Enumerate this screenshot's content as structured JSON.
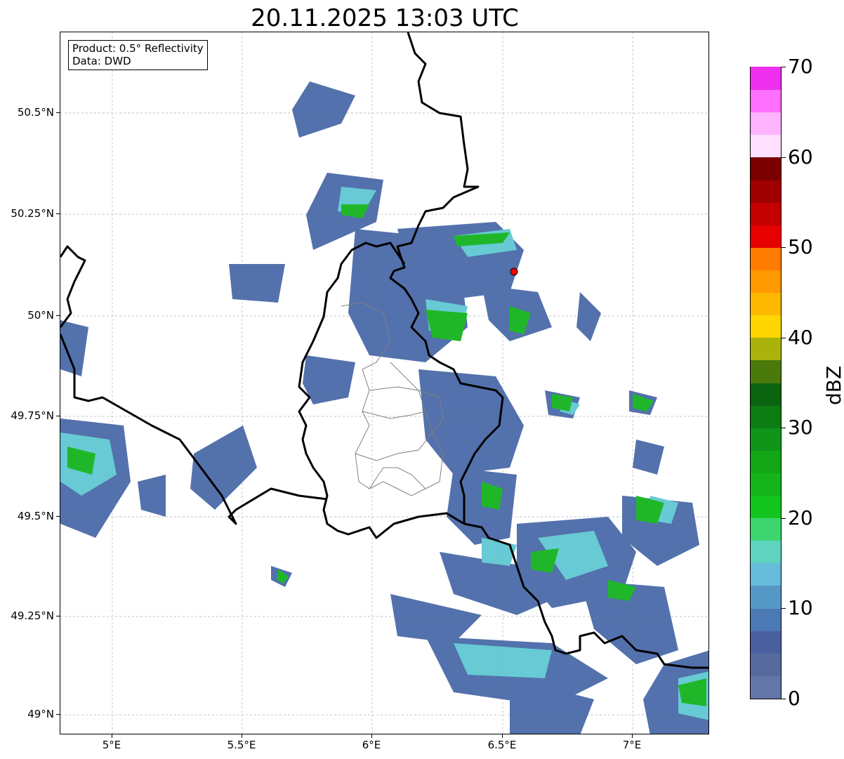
{
  "title": "20.11.2025 13:03 UTC",
  "info_box": {
    "product": "Product: 0.5° Reflectivity",
    "data": "Data: DWD"
  },
  "map": {
    "lon_range": [
      4.8,
      7.3
    ],
    "lat_range": [
      48.95,
      50.7
    ],
    "lat_ticks": [
      {
        "value": 49.0,
        "label": "49°N"
      },
      {
        "value": 49.25,
        "label": "49.25°N"
      },
      {
        "value": 49.5,
        "label": "49.5°N"
      },
      {
        "value": 49.75,
        "label": "49.75°N"
      },
      {
        "value": 50.0,
        "label": "50°N"
      },
      {
        "value": 50.25,
        "label": "50.25°N"
      },
      {
        "value": 50.5,
        "label": "50.5°N"
      }
    ],
    "lon_ticks": [
      {
        "value": 5.0,
        "label": "5°E"
      },
      {
        "value": 5.5,
        "label": "5.5°E"
      },
      {
        "value": 6.0,
        "label": "6°E"
      },
      {
        "value": 6.5,
        "label": "6.5°E"
      },
      {
        "value": 7.0,
        "label": "7°E"
      }
    ],
    "gridlines": true,
    "radar_site_marker_color": "#ff0000"
  },
  "colorbar": {
    "label": "dBZ",
    "min": 0,
    "max": 70,
    "tick_labels": [
      "0",
      "10",
      "20",
      "30",
      "40",
      "50",
      "60",
      "70"
    ],
    "tick_values": [
      0,
      10,
      20,
      30,
      40,
      50,
      60,
      70
    ],
    "step": 2.5,
    "colors": [
      "#6476a8",
      "#566a9e",
      "#4a5fa0",
      "#4a79b4",
      "#5598c6",
      "#66bcda",
      "#5fd2c0",
      "#3dd66e",
      "#14c41e",
      "#14b41a",
      "#12a616",
      "#10941a",
      "#0d7c12",
      "#0a6410",
      "#4a7a0c",
      "#aab20c",
      "#ffd600",
      "#ffb800",
      "#ff9a00",
      "#ff7c00",
      "#e60000",
      "#c40000",
      "#a00000",
      "#7c0000",
      "#ffe0ff",
      "#ffb4ff",
      "#ff70ff",
      "#ee30ee"
    ]
  }
}
